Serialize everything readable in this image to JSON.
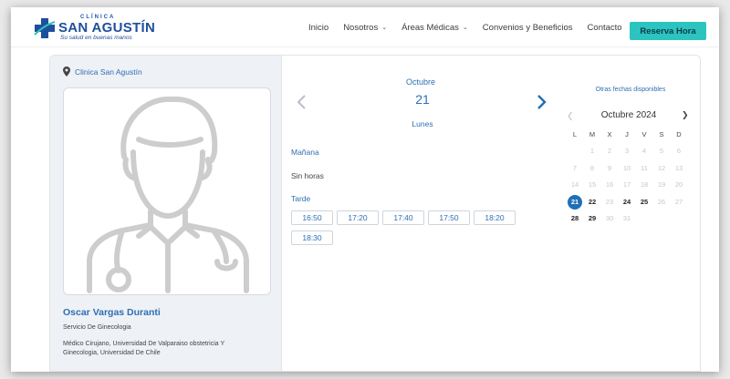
{
  "brand": {
    "small": "CLÍNICA",
    "name": "SAN AGUSTÍN",
    "tagline": "Su salud en buenas manos",
    "color": "#1f4f9c"
  },
  "nav": {
    "items": [
      {
        "label": "Inicio",
        "dropdown": false
      },
      {
        "label": "Nosotros",
        "dropdown": true
      },
      {
        "label": "Áreas Médicas",
        "dropdown": true
      },
      {
        "label": "Convenios y Beneficios",
        "dropdown": false
      },
      {
        "label": "Contacto",
        "dropdown": false
      }
    ],
    "cta": "Reserva Hora",
    "cta_color": "#2bc4be"
  },
  "profile": {
    "location": "Clinica San Agustín",
    "name": "Oscar Vargas Duranti",
    "specialty": "Servicio De Ginecologia",
    "education": "Médico Cirujano, Universidad De Valparaiso obstetricia Y Ginecologia, Universidad De Chile"
  },
  "day": {
    "month": "Octubre",
    "number": "21",
    "weekday": "Lunes",
    "morning_label": "Mañana",
    "morning_empty": "Sin horas",
    "afternoon_label": "Tarde",
    "slots": [
      "16:50",
      "17:20",
      "17:40",
      "17:50",
      "18:20",
      "18:30"
    ]
  },
  "calendar": {
    "other_dates": "Otras fechas disponibles",
    "title": "Octubre 2024",
    "weekdays": [
      "L",
      "M",
      "X",
      "J",
      "V",
      "S",
      "D"
    ],
    "rows": [
      [
        "1",
        "2",
        "3",
        "4",
        "5",
        "6"
      ],
      [
        "7",
        "8",
        "9",
        "10",
        "11",
        "12",
        "13"
      ],
      [
        "14",
        "15",
        "16",
        "17",
        "18",
        "19",
        "20"
      ],
      [
        "21",
        "22",
        "23",
        "24",
        "25",
        "26",
        "27"
      ],
      [
        "28",
        "29",
        "30",
        "31"
      ]
    ],
    "selected": "21",
    "available": [
      "22",
      "24",
      "25",
      "28",
      "29"
    ],
    "accent_color": "#1f6fb5"
  }
}
